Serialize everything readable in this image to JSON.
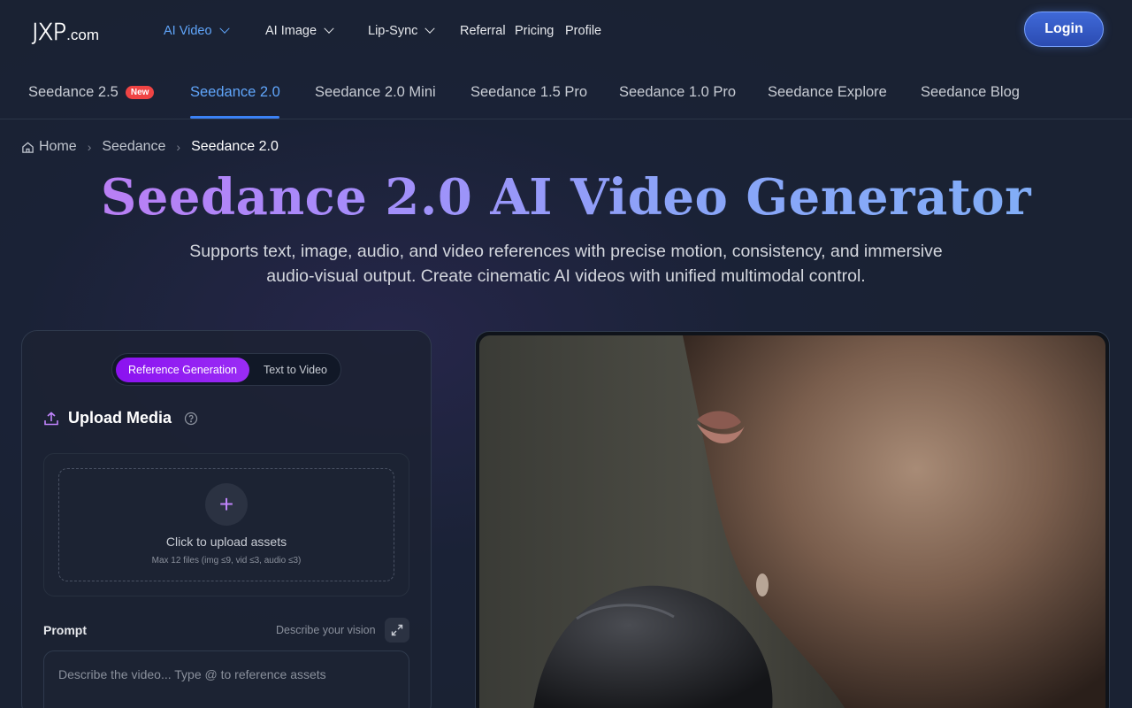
{
  "logo": {
    "mark": "JXP",
    "domain": ".com"
  },
  "nav": {
    "items": [
      {
        "label": "AI Video",
        "dropdown": true,
        "active": true
      },
      {
        "label": "AI Image",
        "dropdown": true
      },
      {
        "label": "Lip-Sync",
        "dropdown": true
      },
      {
        "label": "Referral"
      },
      {
        "label": "Pricing"
      },
      {
        "label": "Profile"
      }
    ],
    "login": "Login"
  },
  "tabs": [
    {
      "label": "Seedance 2.5",
      "badge": "New"
    },
    {
      "label": "Seedance 2.0",
      "active": true
    },
    {
      "label": "Seedance 2.0 Mini"
    },
    {
      "label": "Seedance 1.5 Pro"
    },
    {
      "label": "Seedance 1.0 Pro"
    },
    {
      "label": "Seedance Explore"
    },
    {
      "label": "Seedance Blog"
    }
  ],
  "breadcrumb": {
    "home": "Home",
    "parent": "Seedance",
    "current": "Seedance 2.0"
  },
  "hero": {
    "title": "Seedance 2.0 AI Video Generator",
    "subtitle": "Supports text, image, audio, and video references with precise motion, consistency, and immersive audio-visual output. Create cinematic AI videos with unified multimodal control."
  },
  "generator": {
    "modes": [
      "Reference Generation",
      "Text to Video"
    ],
    "selected_mode": "Reference Generation",
    "upload_title": "Upload Media",
    "upload_cta": "Click to upload assets",
    "upload_limits": "Max 12 files (img ≤9, vid ≤3, audio ≤3)",
    "prompt_label": "Prompt",
    "prompt_hint": "Describe your vision",
    "prompt_placeholder": "Describe the video... Type @ to reference assets"
  },
  "colors": {
    "accent": "#60a5fa",
    "mode_active": "#8b12f0",
    "badge": "#ef4444"
  }
}
